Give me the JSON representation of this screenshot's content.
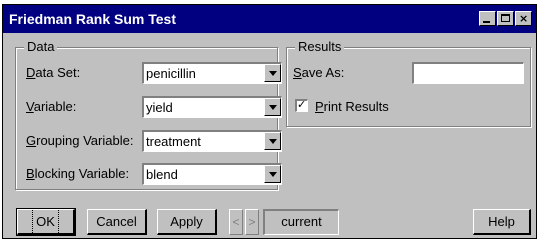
{
  "window": {
    "title": "Friedman Rank Sum Test"
  },
  "data_group": {
    "legend": "Data",
    "fields": [
      {
        "label_pre": "",
        "label_u": "D",
        "label_post": "ata Set:",
        "value": "penicillin"
      },
      {
        "label_pre": "",
        "label_u": "V",
        "label_post": "ariable:",
        "value": "yield"
      },
      {
        "label_pre": "",
        "label_u": "G",
        "label_post": "rouping Variable:",
        "value": "treatment"
      },
      {
        "label_pre": "",
        "label_u": "B",
        "label_post": "locking Variable:",
        "value": "blend"
      }
    ]
  },
  "results_group": {
    "legend": "Results",
    "save_as": {
      "label_pre": "",
      "label_u": "S",
      "label_post": "ave As:",
      "value": ""
    },
    "print_results": {
      "label_pre": "",
      "label_u": "P",
      "label_post": "rint Results",
      "checked": true,
      "mark": "✓"
    }
  },
  "buttons": {
    "ok": "OK",
    "cancel": "Cancel",
    "apply": "Apply",
    "prev": "<",
    "next": ">",
    "current": "current",
    "help": "Help"
  },
  "titlebar_buttons": {
    "minimize": "",
    "maximize": "",
    "close": "×"
  }
}
